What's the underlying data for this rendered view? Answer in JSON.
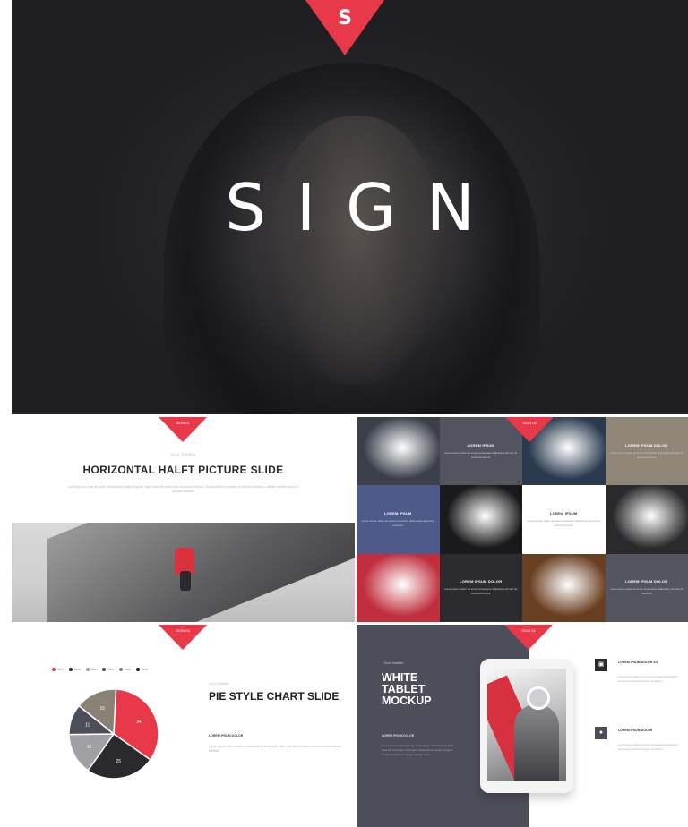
{
  "hero": {
    "title": "SIGN",
    "logo_glyph": "S",
    "accent": "#e8394a"
  },
  "horizontal_slide": {
    "badge": "SIGN 01",
    "subtitle": "Your Subtitle",
    "title": "HORIZONTAL HALFT PICTURE SLIDE",
    "paragraph": "Lorem ipsum dolor sit amet, consectetur adipiscing elit. Nam vitae elit sed turpis commodo ultrices. Donec eleifend mauris id ultricies faucibus. Integer semper lacus ut aliquam aliquet."
  },
  "grid_slide": {
    "badge": "SIGN 02",
    "cells": [
      {
        "kind": "photo",
        "icon": "woman-photo-icon",
        "bg": "#3a3f4a"
      },
      {
        "kind": "text",
        "bg": "#53545f",
        "heading": "LOREM IPSUM",
        "text": "Lorem ipsum dolor sit amet consectetur adipiscing elit sed do eiusmod tempor"
      },
      {
        "kind": "photo",
        "icon": "woman-blue-photo-icon",
        "bg": "#2b3b4f"
      },
      {
        "kind": "text",
        "bg": "#8f8678",
        "heading": "LOREM IPSUM DOLOR",
        "text": "Lorem ipsum dolor sit amet consectetur adipiscing elit sed do eiusmod tempor"
      },
      {
        "kind": "text",
        "bg": "#4e5a8a",
        "heading": "LOREM IPSUM",
        "text": "Lorem ipsum dolor sit amet consectetur adipiscing elit sed do eiusmod"
      },
      {
        "kind": "photo",
        "icon": "architecture-photo-icon",
        "bg": "#1a1a1c"
      },
      {
        "kind": "text",
        "bg": "#ffffff",
        "light": true,
        "heading": "LOREM IPSUM",
        "text": "Lorem ipsum dolor sit amet consectetur adipiscing elit sed do eiusmod tempor"
      },
      {
        "kind": "photo",
        "icon": "silhouette-photo-icon",
        "bg": "#2a2a2c"
      },
      {
        "kind": "photo",
        "icon": "red-portrait-photo-icon",
        "bg": "#c12f3e"
      },
      {
        "kind": "text",
        "bg": "#2b2b30",
        "heading": "LOREM IPSUM DOLOR",
        "text": "Lorem ipsum dolor sit amet consectetur adipiscing elit sed do eiusmod tempor"
      },
      {
        "kind": "photo",
        "icon": "corridor-photo-icon",
        "bg": "#6a3e20"
      },
      {
        "kind": "text",
        "bg": "#54555f",
        "heading": "LOREM IPSUM DOLOR",
        "text": "Lorem ipsum dolor sit amet consectetur adipiscing elit sed do eiusmod"
      }
    ]
  },
  "pie_slide": {
    "badge": "SIGN 03",
    "subtitle": "Your Subtitle",
    "title": "PIE STYLE CHART SLIDE",
    "heading": "LOREM IPSUM DOLOR",
    "paragraph": "Lorem ipsum dolor sit amet, consectetur adipiscing elit. Nam vitae elit sed turpis commodo ultrices donec eleifend.",
    "legend": [
      {
        "label": "Item",
        "color": "#e8394a"
      },
      {
        "label": "Item",
        "color": "#2a2a2e"
      },
      {
        "label": "Item",
        "color": "#a0a0a4"
      },
      {
        "label": "Item",
        "color": "#4d4e5a"
      },
      {
        "label": "Item",
        "color": "#8a8275"
      },
      {
        "label": "Item",
        "color": "#1f1f23"
      }
    ]
  },
  "chart_data": {
    "type": "pie",
    "title": "",
    "slices": [
      {
        "label": "",
        "value": 34,
        "color": "#e8394a"
      },
      {
        "label": "",
        "value": 25,
        "color": "#2a2a2e"
      },
      {
        "label": "",
        "value": 15,
        "color": "#a0a0a4"
      },
      {
        "label": "",
        "value": 11,
        "color": "#4d4e5a"
      },
      {
        "label": "",
        "value": 15,
        "color": "#8a8275"
      }
    ],
    "data_labels": [
      "34",
      "25",
      "15",
      "11",
      "15"
    ]
  },
  "tablet_slide": {
    "badge": "SIGN 04",
    "subtitle": "Your Subtitle",
    "title": "WHITE TABLET MOCKUP",
    "heading": "LOREM IPSUM DOLOR",
    "paragraph": "Lorem ipsum dolor sit amet, consectetur adipiscing elit. Nam vitae elit sed turpis commodo ultrices donec eleifend mauris id ultricies faucibus integer semper lacus.",
    "items": [
      {
        "icon": "image-icon",
        "icon_glyph": "▣",
        "bg": "#2a2a2e",
        "heading": "LOREM IPSUM DOLOR SIT",
        "text": "Lorem ipsum dolor sit amet consectetur adipiscing elit sed do eiusmod tempor incididunt"
      },
      {
        "icon": "lightbulb-icon",
        "icon_glyph": "●",
        "bg": "#4d4e5a",
        "heading": "LOREM IPSUM DOLOR",
        "text": "Lorem ipsum dolor sit amet consectetur adipiscing elit sed do eiusmod tempor incididunt"
      }
    ]
  }
}
